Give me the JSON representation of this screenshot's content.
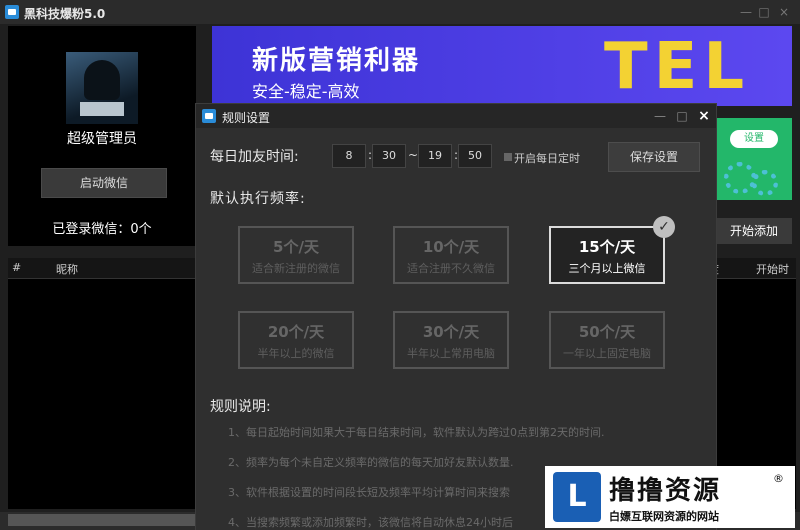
{
  "window": {
    "title": "黑科技爆粉5.0",
    "controls": [
      "—",
      "□",
      "×"
    ]
  },
  "left_panel": {
    "user_name": "超级管理员",
    "start_wechat_label": "启动微信",
    "logged_in_text": "已登录微信：0个"
  },
  "banner": {
    "title": "新版营销利器",
    "subtitle": "安全-稳定-高效",
    "brand": "TEL"
  },
  "settings_card": {
    "label": "设置"
  },
  "start_add_label": "开始添加",
  "grid": {
    "columns": [
      "#",
      "昵称",
      "度",
      "开始时间"
    ]
  },
  "dialog": {
    "title": "规则设置",
    "controls": [
      "—",
      "□",
      "×"
    ],
    "daily_label": "每日加友时间:",
    "time": {
      "start_hour": "8",
      "start_min": "30",
      "end_hour": "19",
      "end_min": "50",
      "sep1": ":",
      "dash": "~",
      "sep2": ":"
    },
    "daily_timer_label": "开启每日定时",
    "save_label": "保存设置",
    "frequency_label": "默认执行频率:",
    "frequencies": [
      {
        "main": "5个/天",
        "sub": "适合新注册的微信"
      },
      {
        "main": "10个/天",
        "sub": "适合注册不久微信"
      },
      {
        "main": "15个/天",
        "sub": "三个月以上微信"
      },
      {
        "main": "20个/天",
        "sub": "半年以上的微信"
      },
      {
        "main": "30个/天",
        "sub": "半年以上常用电脑"
      },
      {
        "main": "50个/天",
        "sub": "一年以上固定电脑"
      }
    ],
    "selected_frequency": "15个/天",
    "rules_label": "规则说明:",
    "rules": [
      "1、每日起始时间如果大于每日结束时间，软件默认为跨过0点到第2天的时间.",
      "2、频率为每个未自定义频率的微信的每天加好友默认数量.",
      "3、软件根据设置的时间段长短及频率平均计算时间来搜索",
      "4、当搜索频繁或添加频繁时，该微信将自动休息24小时后"
    ]
  },
  "watermark": {
    "logo": "L",
    "title": "撸撸资源",
    "sub": "白嫖互联网资源的网站",
    "reg": "®"
  }
}
